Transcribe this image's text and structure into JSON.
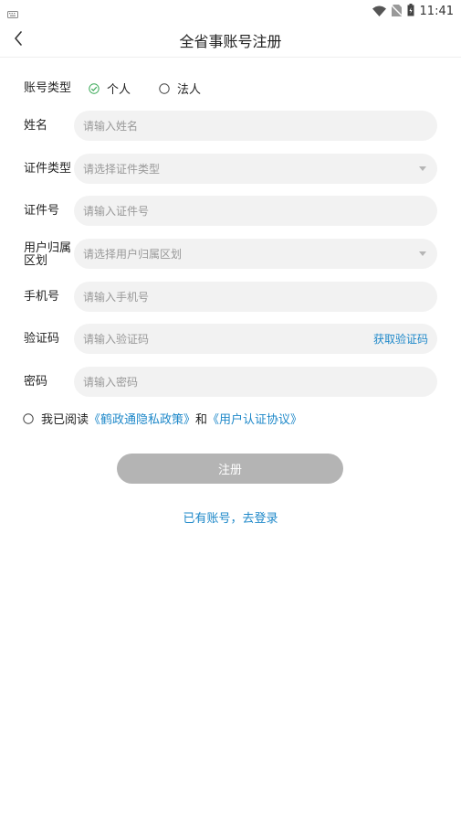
{
  "status_bar": {
    "time": "11:41"
  },
  "header": {
    "title": "全省事账号注册"
  },
  "account_type": {
    "label": "账号类型",
    "options": [
      {
        "label": "个人",
        "selected": true
      },
      {
        "label": "法人",
        "selected": false
      }
    ]
  },
  "fields": {
    "name": {
      "label": "姓名",
      "placeholder": "请输入姓名"
    },
    "id_type": {
      "label": "证件类型",
      "placeholder": "请选择证件类型"
    },
    "id_number": {
      "label": "证件号",
      "placeholder": "请输入证件号"
    },
    "region": {
      "label_line1": "用户归属",
      "label_line2": "区划",
      "placeholder": "请选择用户归属区划"
    },
    "phone": {
      "label": "手机号",
      "placeholder": "请输入手机号"
    },
    "code": {
      "label": "验证码",
      "placeholder": "请输入验证码",
      "action": "获取验证码"
    },
    "password": {
      "label": "密码",
      "placeholder": "请输入密码"
    }
  },
  "agreement": {
    "prefix": "我已阅读",
    "privacy_link": "《鹤政通隐私政策》",
    "conjunction": "和",
    "terms_link": "《用户认证协议》"
  },
  "submit_label": "注册",
  "login_link": "已有账号，去登录",
  "colors": {
    "link": "#1e88c9",
    "check": "#3aa957",
    "button_disabled": "#b4b4b4",
    "field_bg": "#f2f2f2"
  }
}
